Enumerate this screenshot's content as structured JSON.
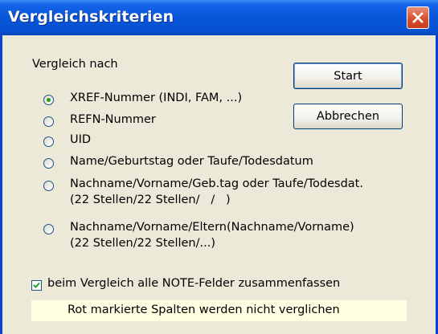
{
  "window": {
    "title": "Vergleichskriterien"
  },
  "icons": {
    "close": "close-icon",
    "check": "checkmark-icon"
  },
  "colors": {
    "titlebar": "#0756d8",
    "close_button": "#d9512f",
    "dialog_bg": "#ece9d8",
    "info_bg": "#ffffe1"
  },
  "group_label": "Vergleich nach",
  "buttons": {
    "start": "Start",
    "cancel": "Abbrechen"
  },
  "options": [
    {
      "line1": "XREF-Nummer (INDI, FAM, ...)",
      "line2": "",
      "selected": true
    },
    {
      "line1": "REFN-Nummer",
      "line2": "",
      "selected": false
    },
    {
      "line1": "UID",
      "line2": "",
      "selected": false
    },
    {
      "line1": "Name/Geburtstag oder Taufe/Todesdatum",
      "line2": "",
      "selected": false
    },
    {
      "line1": "Nachname/Vorname/Geb.tag oder Taufe/Todesdat.",
      "line2": "(22 Stellen/22 Stellen/   /   )",
      "selected": false
    },
    {
      "line1": "Nachname/Vorname/Eltern(Nachname/Vorname)",
      "line2": "(22 Stellen/22 Stellen/...)",
      "selected": false
    }
  ],
  "note_checkbox": {
    "label": "beim Vergleich alle NOTE-Felder zusammenfassen",
    "checked": true
  },
  "info_text": "Rot markierte Spalten werden nicht verglichen"
}
